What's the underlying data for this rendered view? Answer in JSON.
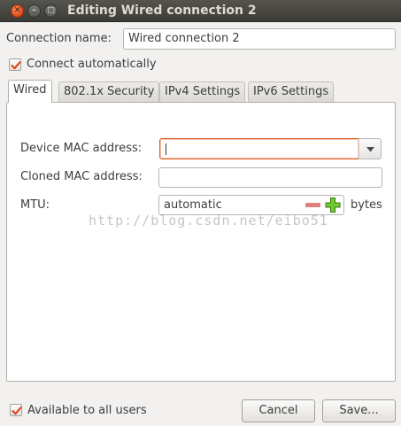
{
  "window": {
    "title": "Editing Wired connection 2",
    "close_icon": "close-icon",
    "minimize_icon": "minimize-icon",
    "maximize_icon": "maximize-icon"
  },
  "connection": {
    "name_label": "Connection name:",
    "name_value": "Wired connection 2",
    "connect_auto_label": "Connect automatically",
    "connect_auto_checked": true
  },
  "tabs": [
    {
      "label": "Wired",
      "active": true
    },
    {
      "label": "802.1x Security",
      "active": false
    },
    {
      "label": "IPv4 Settings",
      "active": false
    },
    {
      "label": "IPv6 Settings",
      "active": false
    }
  ],
  "wired": {
    "device_mac_label": "Device MAC address:",
    "device_mac_value": "",
    "cloned_mac_label": "Cloned MAC address:",
    "cloned_mac_value": "",
    "mtu_label": "MTU:",
    "mtu_value": "automatic",
    "mtu_unit": "bytes"
  },
  "watermark": "http://blog.csdn.net/eibo51",
  "footer": {
    "available_label": "Available to all users",
    "available_checked": true,
    "cancel_label": "Cancel",
    "save_label": "Save..."
  },
  "colors": {
    "accent": "#dd4814",
    "plus_green": "#4e9a06",
    "minus_red": "#e08080"
  }
}
